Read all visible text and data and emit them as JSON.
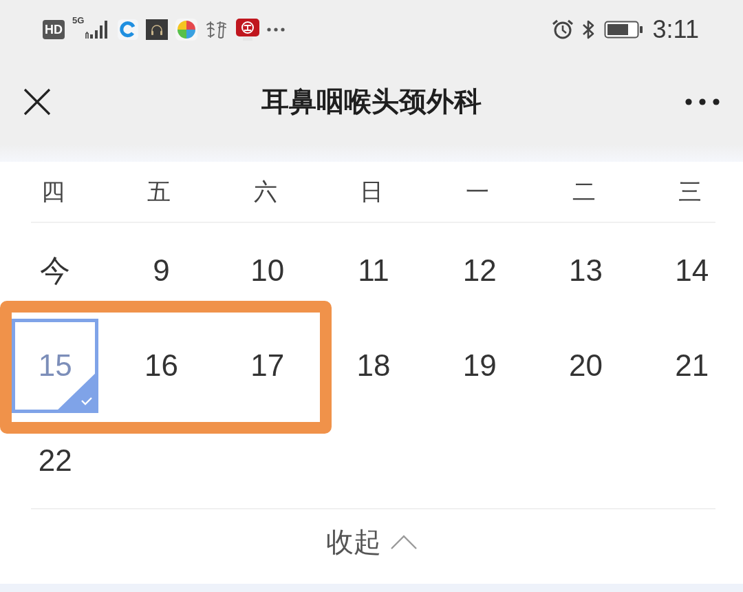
{
  "status_bar": {
    "network_badge": "HD",
    "network_type": "5G",
    "time": "3:11"
  },
  "nav": {
    "title": "耳鼻咽喉头颈外科"
  },
  "calendar": {
    "weekdays": [
      "四",
      "五",
      "六",
      "日",
      "一",
      "二",
      "三"
    ],
    "weeks": [
      [
        {
          "label": "今",
          "selected": false,
          "highlighted": false
        },
        {
          "label": "9",
          "selected": false,
          "highlighted": false
        },
        {
          "label": "10",
          "selected": false,
          "highlighted": false
        },
        {
          "label": "11",
          "selected": false,
          "highlighted": false
        },
        {
          "label": "12",
          "selected": false,
          "highlighted": false
        },
        {
          "label": "13",
          "selected": false,
          "highlighted": false
        },
        {
          "label": "14",
          "selected": false,
          "highlighted": false
        }
      ],
      [
        {
          "label": "15",
          "selected": true,
          "highlighted": true
        },
        {
          "label": "16",
          "selected": false,
          "highlighted": true
        },
        {
          "label": "17",
          "selected": false,
          "highlighted": true
        },
        {
          "label": "18",
          "selected": false,
          "highlighted": false
        },
        {
          "label": "19",
          "selected": false,
          "highlighted": false
        },
        {
          "label": "20",
          "selected": false,
          "highlighted": false
        },
        {
          "label": "21",
          "selected": false,
          "highlighted": false
        }
      ],
      [
        {
          "label": "22",
          "selected": false,
          "highlighted": false
        }
      ]
    ],
    "collapse": {
      "label": "收起"
    }
  }
}
